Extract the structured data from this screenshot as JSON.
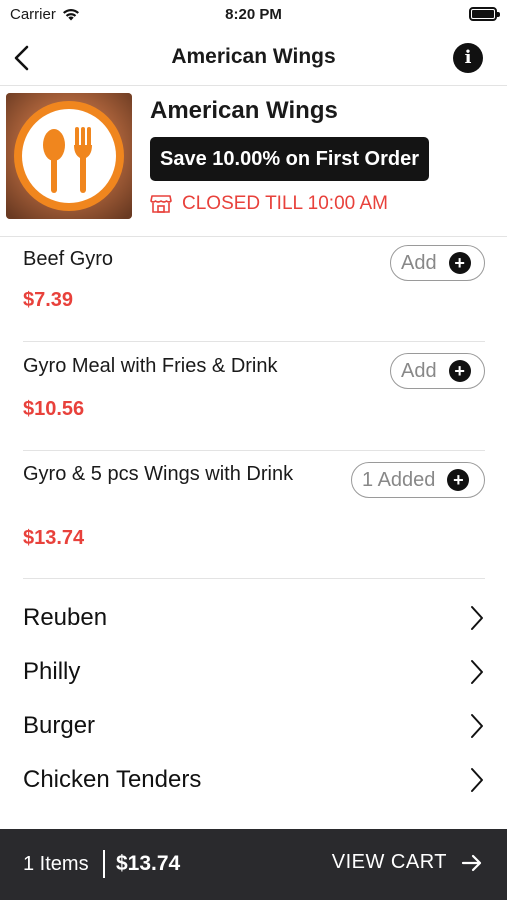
{
  "status_bar": {
    "carrier": "Carrier",
    "time": "8:20 PM"
  },
  "nav": {
    "title": "American Wings",
    "back_icon": "chevron-left-icon",
    "info_icon": "info-icon"
  },
  "restaurant": {
    "name": "American Wings",
    "promo": "Save 10.00% on First Order",
    "status": "CLOSED TILL 10:00 AM",
    "logo_icon": "spoon-fork-icon",
    "accent": "#e8413b",
    "logo_color": "#f0861e"
  },
  "items": [
    {
      "name": "Beef Gyro",
      "price": "$7.39",
      "button": "Add"
    },
    {
      "name": "Gyro Meal with Fries & Drink",
      "price": "$10.56",
      "button": "Add"
    },
    {
      "name": "Gyro & 5 pcs Wings with Drink",
      "price": "$13.74",
      "button": "1 Added"
    }
  ],
  "categories": [
    {
      "label": "Reuben"
    },
    {
      "label": "Philly"
    },
    {
      "label": "Burger"
    },
    {
      "label": "Chicken Tenders"
    }
  ],
  "cart": {
    "count": "1 Items",
    "total": "$13.74",
    "view_label": "VIEW CART"
  }
}
